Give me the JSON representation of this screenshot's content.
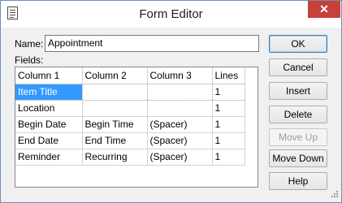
{
  "window": {
    "title": "Form Editor",
    "close_glyph": "✕",
    "icon": "form-document-icon"
  },
  "form": {
    "name_label": "Name:",
    "name_value": "Appointment",
    "fields_label": "Fields:"
  },
  "grid": {
    "columns": [
      "Column 1",
      "Column 2",
      "Column 3",
      "Lines"
    ],
    "rows": [
      [
        "Item Title",
        "",
        "",
        "1"
      ],
      [
        "Location",
        "",
        "",
        "1"
      ],
      [
        "Begin Date",
        "Begin Time",
        "(Spacer)",
        "1"
      ],
      [
        "End Date",
        "End Time",
        "(Spacer)",
        "1"
      ],
      [
        "Reminder",
        "Recurring",
        "(Spacer)",
        "1"
      ]
    ],
    "selected_row": 0,
    "selection_color": "#3399ff"
  },
  "buttons": {
    "ok": "OK",
    "cancel": "Cancel",
    "insert": "Insert",
    "delete": "Delete",
    "move_up": "Move Up",
    "move_down": "Move Down",
    "help": "Help"
  },
  "colors": {
    "close_button": "#c7403a",
    "window_border": "#6d8fb8"
  }
}
